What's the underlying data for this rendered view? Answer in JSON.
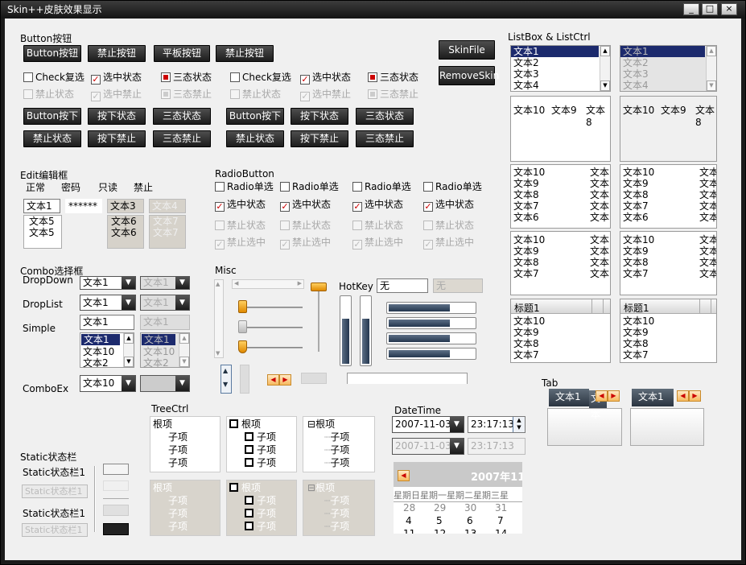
{
  "window": {
    "title": "Skin++皮肤效果显示",
    "min_label": "_",
    "max_label": "□",
    "close_label": "×"
  },
  "buttons": {
    "section": "Button按钮",
    "row1": [
      "Button按钮",
      "禁止按钮",
      "平板按钮",
      "禁止按钮"
    ],
    "skinfile": "SkinFile",
    "removeskin": "RemoveSkin",
    "push_row1": [
      "Button按下",
      "按下状态",
      "三态状态",
      "Button按下",
      "按下状态",
      "三态状态"
    ],
    "push_row2": [
      "禁止状态",
      "按下禁止",
      "三态禁止",
      "禁止状态",
      "按下禁止",
      "三态禁止"
    ]
  },
  "checks": {
    "row1": [
      "Check复选",
      "选中状态",
      "三态状态",
      "Check复选",
      "选中状态",
      "三态状态"
    ],
    "row2": [
      "禁止状态",
      "选中禁止",
      "三态禁止",
      "禁止状态",
      "选中禁止",
      "三态禁止"
    ]
  },
  "edit": {
    "section": "Edit编辑框",
    "headers": [
      "正常",
      "密码",
      "只读",
      "禁止"
    ],
    "normal": "文本1",
    "password": "******",
    "readonly": "文本3",
    "disabled": "文本4",
    "multi_normal": [
      "文本5",
      "文本5"
    ],
    "multi_readonly": [
      "文本6",
      "文本6"
    ],
    "multi_disabled": [
      "文本7",
      "文本7"
    ]
  },
  "radio": {
    "section": "RadioButton",
    "row1": [
      "Radio单选",
      "Radio单选",
      "Radio单选",
      "Radio单选"
    ],
    "row2": [
      "选中状态",
      "选中状态",
      "选中状态",
      "选中状态"
    ],
    "row3": [
      "禁止状态",
      "禁止状态",
      "禁止状态",
      "禁止状态"
    ],
    "row4": [
      "禁止选中",
      "禁止选中",
      "禁止选中",
      "禁止选中"
    ]
  },
  "combo": {
    "section": "Combo选择框",
    "labels": [
      "DropDown",
      "DropList",
      "Simple",
      "ComboEx"
    ],
    "dropdown": "文本1",
    "dropdown_dis": "文本1",
    "droplist": "文本1",
    "droplist_dis": "文本1",
    "simple": "文本1",
    "simple_dis": "文本1",
    "simple_list": [
      "文本1",
      "文本10",
      "文本2"
    ],
    "simple_list_dis": [
      "文本1",
      "文本10",
      "文本2"
    ],
    "comboex": "文本10",
    "comboex_dis": "文本10"
  },
  "misc": {
    "section": "Misc",
    "hotkey_label": "HotKey",
    "hotkey_value": "无",
    "hotkey_dis": "无"
  },
  "progress": {
    "horizontal": [
      0.72,
      0.72,
      0.72,
      0.72
    ],
    "vertical": [
      0.68,
      0.68
    ]
  },
  "listbox": {
    "section": "ListBox & ListCtrl",
    "items": [
      "文本1",
      "文本2",
      "文本3",
      "文本4"
    ],
    "icon_row": [
      "文本10",
      "文本9",
      "文本8"
    ],
    "report_rows": [
      [
        "文本10",
        "文本"
      ],
      [
        "文本9",
        "文本"
      ],
      [
        "文本8",
        "文本"
      ],
      [
        "文本7",
        "文本"
      ],
      [
        "文本6",
        "文本"
      ]
    ],
    "report_rows2": [
      [
        "文本10",
        "文本"
      ],
      [
        "文本9",
        "文本"
      ],
      [
        "文本8",
        "文本"
      ],
      [
        "文本7",
        "文本"
      ]
    ],
    "header": "标题1",
    "header_rows": [
      "文本10",
      "文本9",
      "文本8",
      "文本7"
    ]
  },
  "tab": {
    "section": "Tab",
    "tab1": "文本1",
    "tab1_ghost": "文本",
    "tab2": "文本1"
  },
  "tree": {
    "section": "TreeCtrl",
    "root": "根项",
    "child": "子项"
  },
  "datetime": {
    "section": "DateTime",
    "date": "2007-11-03",
    "time": "23:17:13",
    "date_dis": "2007-11-03",
    "time_dis": "23:17:13",
    "cal_title": "2007年11月",
    "weekdays": [
      "星期日",
      "星期一",
      "星期二",
      "星期三",
      "星"
    ],
    "week1": [
      "28",
      "29",
      "30",
      "31"
    ],
    "week2": [
      "4",
      "5",
      "6",
      "7"
    ],
    "week3": [
      "11",
      "12",
      "13",
      "14"
    ]
  },
  "static": {
    "section": "Static状态栏",
    "label1": "Static状态栏1",
    "label2": "Static状态栏1",
    "label3": "Static状态栏1",
    "label4": "Static状态栏1"
  }
}
